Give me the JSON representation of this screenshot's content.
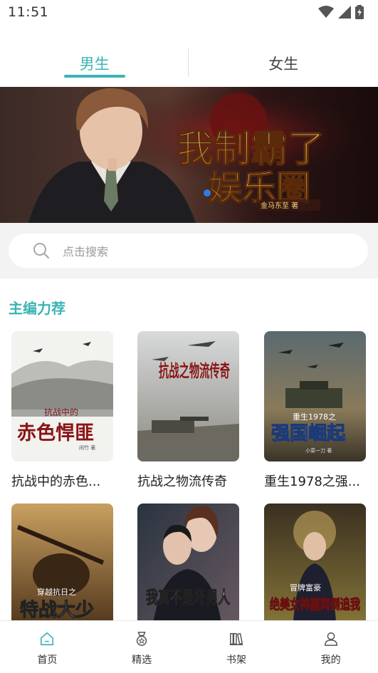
{
  "status_bar": {
    "time": "11:51"
  },
  "tabs": [
    {
      "label": "男生",
      "active": true
    },
    {
      "label": "女生",
      "active": false
    }
  ],
  "banner": {
    "title_line1": "我制霸了",
    "title_line2": "娱乐圈",
    "author": "金马东至 著"
  },
  "search": {
    "placeholder": "点击搜索"
  },
  "section": {
    "title": "主编力荐"
  },
  "books": [
    {
      "title": "抗战中的赤色...",
      "cover_small": "抗战中的",
      "cover_big": "赤色悍匪",
      "cover_author": "闲竹 著"
    },
    {
      "title": "抗战之物流传奇",
      "cover_small": "",
      "cover_big": "抗战之物流传奇",
      "cover_author": ""
    },
    {
      "title": "重生1978之强...",
      "cover_small": "重生1978之",
      "cover_big": "强国崛起",
      "cover_author": "小菜一刀 著"
    },
    {
      "title": "",
      "cover_small": "穿越抗日之",
      "cover_big": "特战大少",
      "cover_author": ""
    },
    {
      "title": "",
      "cover_small": "",
      "cover_big": "我真不是坏男人",
      "cover_author": ""
    },
    {
      "title": "",
      "cover_small": "冒牌富豪",
      "cover_big": "绝美女神嘉宾倒追我",
      "cover_author": ""
    }
  ],
  "bottom_nav": [
    {
      "label": "首页",
      "icon": "home-icon",
      "active": true
    },
    {
      "label": "精选",
      "icon": "medal-icon",
      "active": false
    },
    {
      "label": "书架",
      "icon": "bookshelf-icon",
      "active": false
    },
    {
      "label": "我的",
      "icon": "user-icon",
      "active": false
    }
  ],
  "colors": {
    "accent": "#3bb3b5",
    "banner_dot": "#2f7de1",
    "search_bg": "#f3f3f3"
  }
}
